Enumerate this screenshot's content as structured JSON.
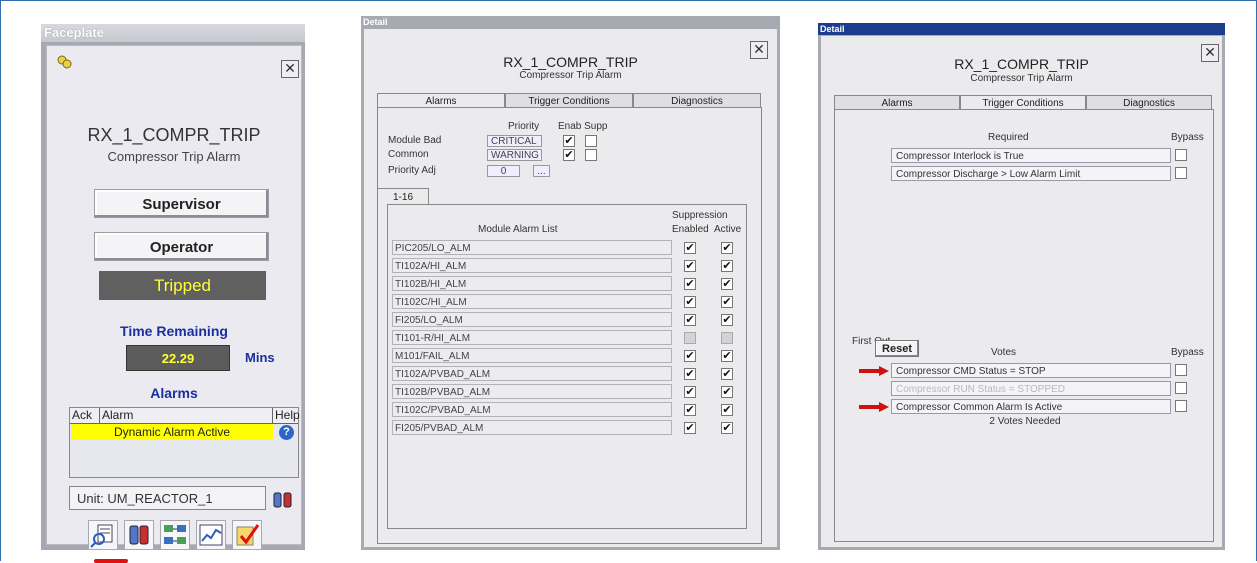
{
  "faceplate": {
    "title": "Faceplate",
    "tag": "RX_1_COMPR_TRIP",
    "description": "Compressor Trip Alarm",
    "supervisor_btn": "Supervisor",
    "operator_btn": "Operator",
    "status": "Tripped",
    "time_remaining_label": "Time Remaining",
    "time_value": "22.29",
    "time_unit": "Mins",
    "alarms_label": "Alarms",
    "alarm_table": {
      "headers": [
        "Ack",
        "Alarm",
        "Help"
      ],
      "row": "Dynamic Alarm Active"
    },
    "unit": "Unit: UM_REACTOR_1",
    "colors": {
      "status_text": "#ffff33",
      "label_blue": "#1a2fa0",
      "alarm_row": "#ffff00",
      "underline": "#e01010"
    },
    "icons": [
      "detail-icon",
      "unit-icon",
      "module-icon",
      "trend-icon",
      "acknowledge-icon"
    ]
  },
  "detail1": {
    "title": "Detail",
    "tag": "RX_1_COMPR_TRIP",
    "description": "Compressor Trip Alarm",
    "tabs": [
      "Alarms",
      "Trigger Conditions",
      "Diagnostics"
    ],
    "priority_header": "Priority",
    "enab_supp_header": "Enab Supp",
    "module_bad_label": "Module Bad",
    "module_bad_priority": "CRITICAL",
    "common_label": "Common",
    "common_priority": "WARNING",
    "priority_adj_label": "Priority Adj",
    "priority_adj_value": "0",
    "ellipsis": "...",
    "subtab": "1-16",
    "suppression_label": "Suppression",
    "list_header": "Module Alarm List",
    "enabled_label": "Enabled",
    "active_label": "Active",
    "alarms": [
      "PIC205/LO_ALM",
      "TI102A/HI_ALM",
      "TI102B/HI_ALM",
      "TI102C/HI_ALM",
      "FI205/LO_ALM",
      "TI101-R/HI_ALM",
      "M101/FAIL_ALM",
      "TI102A/PVBAD_ALM",
      "TI102B/PVBAD_ALM",
      "TI102C/PVBAD_ALM",
      "FI205/PVBAD_ALM"
    ]
  },
  "detail2": {
    "title": "Detail",
    "tag": "RX_1_COMPR_TRIP",
    "description": "Compressor Trip Alarm",
    "tabs": [
      "Alarms",
      "Trigger Conditions",
      "Diagnostics"
    ],
    "required_label": "Required",
    "bypass_label": "Bypass",
    "required": [
      "Compressor Interlock is True",
      "Compressor Discharge > Low Alarm Limit"
    ],
    "first_out_label": "First Out",
    "reset_btn": "Reset",
    "votes_label": "Votes",
    "votes_bypass_label": "Bypass",
    "votes": [
      "Compressor CMD Status = STOP",
      "Compressor RUN Status = STOPPED",
      "Compressor Common Alarm Is Active"
    ],
    "votes_needed": "2 Votes Needed"
  }
}
